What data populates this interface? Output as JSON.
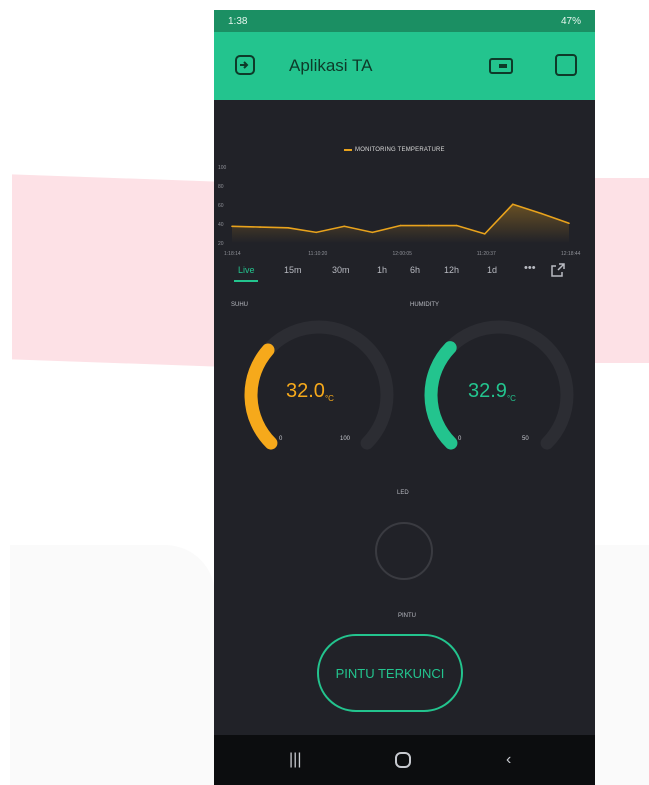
{
  "status_bar": {
    "time": "1:38",
    "right_text": "47%"
  },
  "header": {
    "title": "Aplikasi TA"
  },
  "chart_data": {
    "type": "line",
    "legend": [
      "MONITORING TEMPERATURE"
    ],
    "x_tick_labels": [
      "1:18:14",
      "11:10:20",
      "12:00:05",
      "11:20:37",
      "12:18:44"
    ],
    "y_tick_labels": [
      "100",
      "80",
      "60",
      "40",
      "20"
    ],
    "series": [
      {
        "name": "MONITORING TEMPERATURE",
        "color": "#e9a31c",
        "values": [
          22,
          21,
          20,
          14,
          22,
          14,
          23,
          23,
          23,
          12,
          51,
          39,
          26
        ]
      }
    ],
    "ylim": [
      0,
      100
    ]
  },
  "time_tabs": [
    "Live",
    "15m",
    "30m",
    "1h",
    "6h",
    "12h",
    "1d"
  ],
  "gauges": [
    {
      "label": "SUHU",
      "value": "32.0",
      "unit": "°C",
      "min": "0",
      "max": "100",
      "fraction": 0.32,
      "color": "#f6a91b"
    },
    {
      "label": "HUMIDITY",
      "value": "32.9",
      "unit": "°C",
      "min": "0",
      "max": "50",
      "fraction": 0.33,
      "color": "#23c48e"
    }
  ],
  "led": {
    "label": "LED"
  },
  "door": {
    "label": "PINTU",
    "button_label": "PINTU TERKUNCI"
  }
}
